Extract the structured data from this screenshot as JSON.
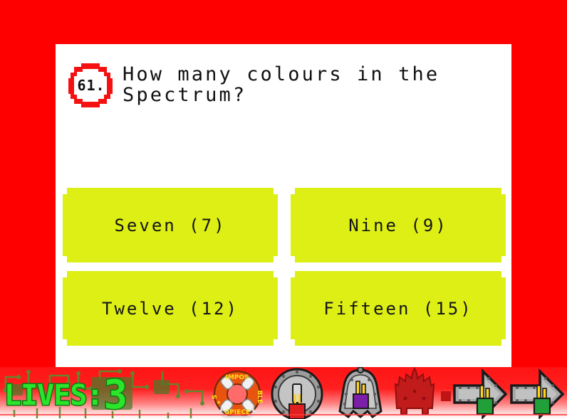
{
  "theme": {
    "background": "#FF0000",
    "panel_bg": "#FFFFFF",
    "answer_bg": "#DDEF15",
    "answer_text": "#141414",
    "badge_red": "#F51111",
    "lives_green": "#2BE52B",
    "lives_outline": "#0E7A12"
  },
  "quiz": {
    "number": "61.",
    "question": "How many colours in the\nSpectrum?",
    "answers": [
      {
        "label": "Seven (7)"
      },
      {
        "label": "Nine (9)"
      },
      {
        "label": "Twelve (12)"
      },
      {
        "label": "Fifteen (15)"
      }
    ]
  },
  "hud": {
    "lives_label": "LIVES:",
    "lives_count": "3",
    "items": [
      {
        "name": "life-ring",
        "title": "IMPOSSIBLE"
      },
      {
        "name": "metal-disc-shield",
        "title": ""
      },
      {
        "name": "bell-shield",
        "title": ""
      },
      {
        "name": "red-crown",
        "title": ""
      },
      {
        "name": "arrow-right-1",
        "title": ""
      },
      {
        "name": "arrow-right-2",
        "title": ""
      }
    ],
    "life_ring_text_top": "IMPOS",
    "life_ring_text_right": "BLE",
    "life_ring_text_bottom": "GPIECE",
    "life_ring_text_left": "S"
  }
}
